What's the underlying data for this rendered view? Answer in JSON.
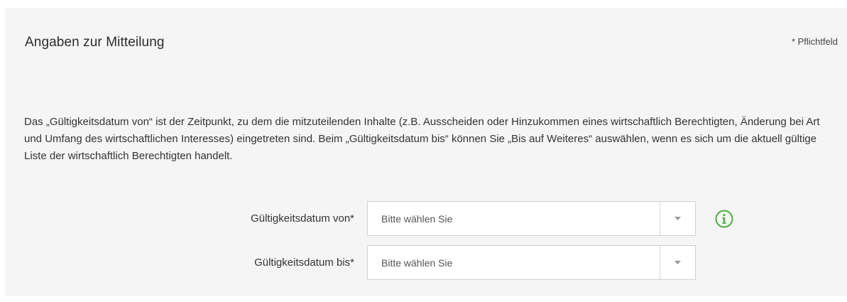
{
  "section": {
    "title": "Angaben zur Mitteilung",
    "required_note": "* Pflichtfeld",
    "description": "Das „Gültigkeitsdatum von“ ist der Zeitpunkt, zu dem die mitzuteilenden Inhalte (z.B. Ausscheiden oder Hinzukommen eines wirtschaftlich Berechtigten, Änderung bei Art und Umfang des wirtschaftlichen Interesses) eingetreten sind. Beim „Gültigkeitsdatum bis“ können Sie „Bis auf Weiteres“ auswählen, wenn es sich um die aktuell gültige Liste der wirtschaftlich Berechtigten handelt."
  },
  "fields": {
    "valid_from": {
      "label": "Gültigkeitsdatum von*",
      "value": "Bitte wählen Sie"
    },
    "valid_to": {
      "label": "Gültigkeitsdatum bis*",
      "value": "Bitte wählen Sie"
    }
  },
  "icons": {
    "info": "info-circle-icon",
    "dropdown": "caret-down-icon"
  },
  "colors": {
    "panel_background": "#f5f5f5",
    "info_icon": "#4caf3f",
    "select_border": "#d0d0d0"
  }
}
